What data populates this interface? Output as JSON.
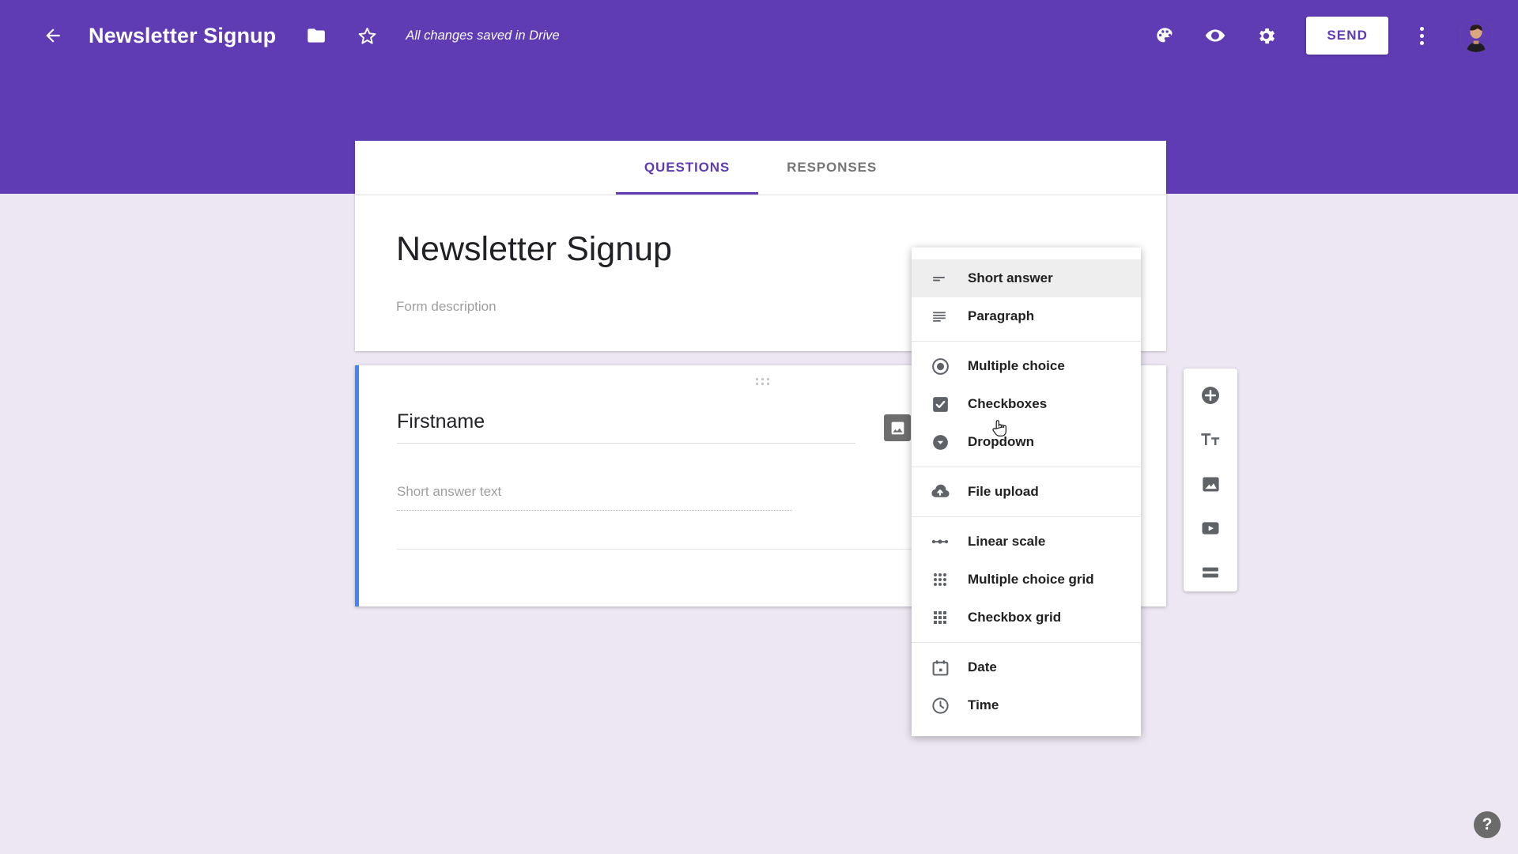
{
  "header": {
    "back_icon": "back-arrow-icon",
    "doc_title": "Newsletter Signup",
    "folder_icon": "folder-icon",
    "star_icon": "star-icon",
    "save_status": "All changes saved in Drive",
    "theme_icon": "palette-icon",
    "preview_icon": "eye-icon",
    "settings_icon": "gear-icon",
    "send_label": "SEND",
    "more_icon": "kebab-menu-icon",
    "avatar_label": "account-avatar",
    "bg_color": "#5F3CB4"
  },
  "tabs": [
    {
      "label": "QUESTIONS",
      "active": true
    },
    {
      "label": "RESPONSES",
      "active": false
    }
  ],
  "form": {
    "title": "Newsletter Signup",
    "description": "Form description"
  },
  "question": {
    "title": "Firstname",
    "answer_placeholder": "Short answer text",
    "image_icon": "image-icon",
    "duplicate_icon": "duplicate-icon",
    "drag_icon": "drag-handle-icon",
    "accent_color": "#4285F4"
  },
  "type_menu": {
    "groups": [
      {
        "items": [
          {
            "label": "Short answer",
            "icon": "short-answer-icon",
            "selected": true
          },
          {
            "label": "Paragraph",
            "icon": "paragraph-icon",
            "selected": false
          }
        ]
      },
      {
        "items": [
          {
            "label": "Multiple choice",
            "icon": "radio-button-icon",
            "selected": false
          },
          {
            "label": "Checkboxes",
            "icon": "checkbox-icon",
            "selected": false
          },
          {
            "label": "Dropdown",
            "icon": "dropdown-icon",
            "selected": false
          }
        ]
      },
      {
        "items": [
          {
            "label": "File upload",
            "icon": "cloud-upload-icon",
            "selected": false
          }
        ]
      },
      {
        "items": [
          {
            "label": "Linear scale",
            "icon": "linear-scale-icon",
            "selected": false
          },
          {
            "label": "Multiple choice grid",
            "icon": "dot-grid-icon",
            "selected": false
          },
          {
            "label": "Checkbox grid",
            "icon": "square-grid-icon",
            "selected": false
          }
        ]
      },
      {
        "items": [
          {
            "label": "Date",
            "icon": "calendar-icon",
            "selected": false
          },
          {
            "label": "Time",
            "icon": "clock-icon",
            "selected": false
          }
        ]
      }
    ]
  },
  "side_toolbar": {
    "buttons": [
      {
        "icon": "add-question-icon"
      },
      {
        "icon": "add-title-icon"
      },
      {
        "icon": "add-image-icon"
      },
      {
        "icon": "add-video-icon"
      },
      {
        "icon": "add-section-icon"
      }
    ]
  },
  "help": {
    "label": "?",
    "icon": "help-icon"
  },
  "colors": {
    "page_background": "#EDE7F3",
    "brand_purple": "#5F3CB4",
    "question_accent": "#4285F4"
  }
}
